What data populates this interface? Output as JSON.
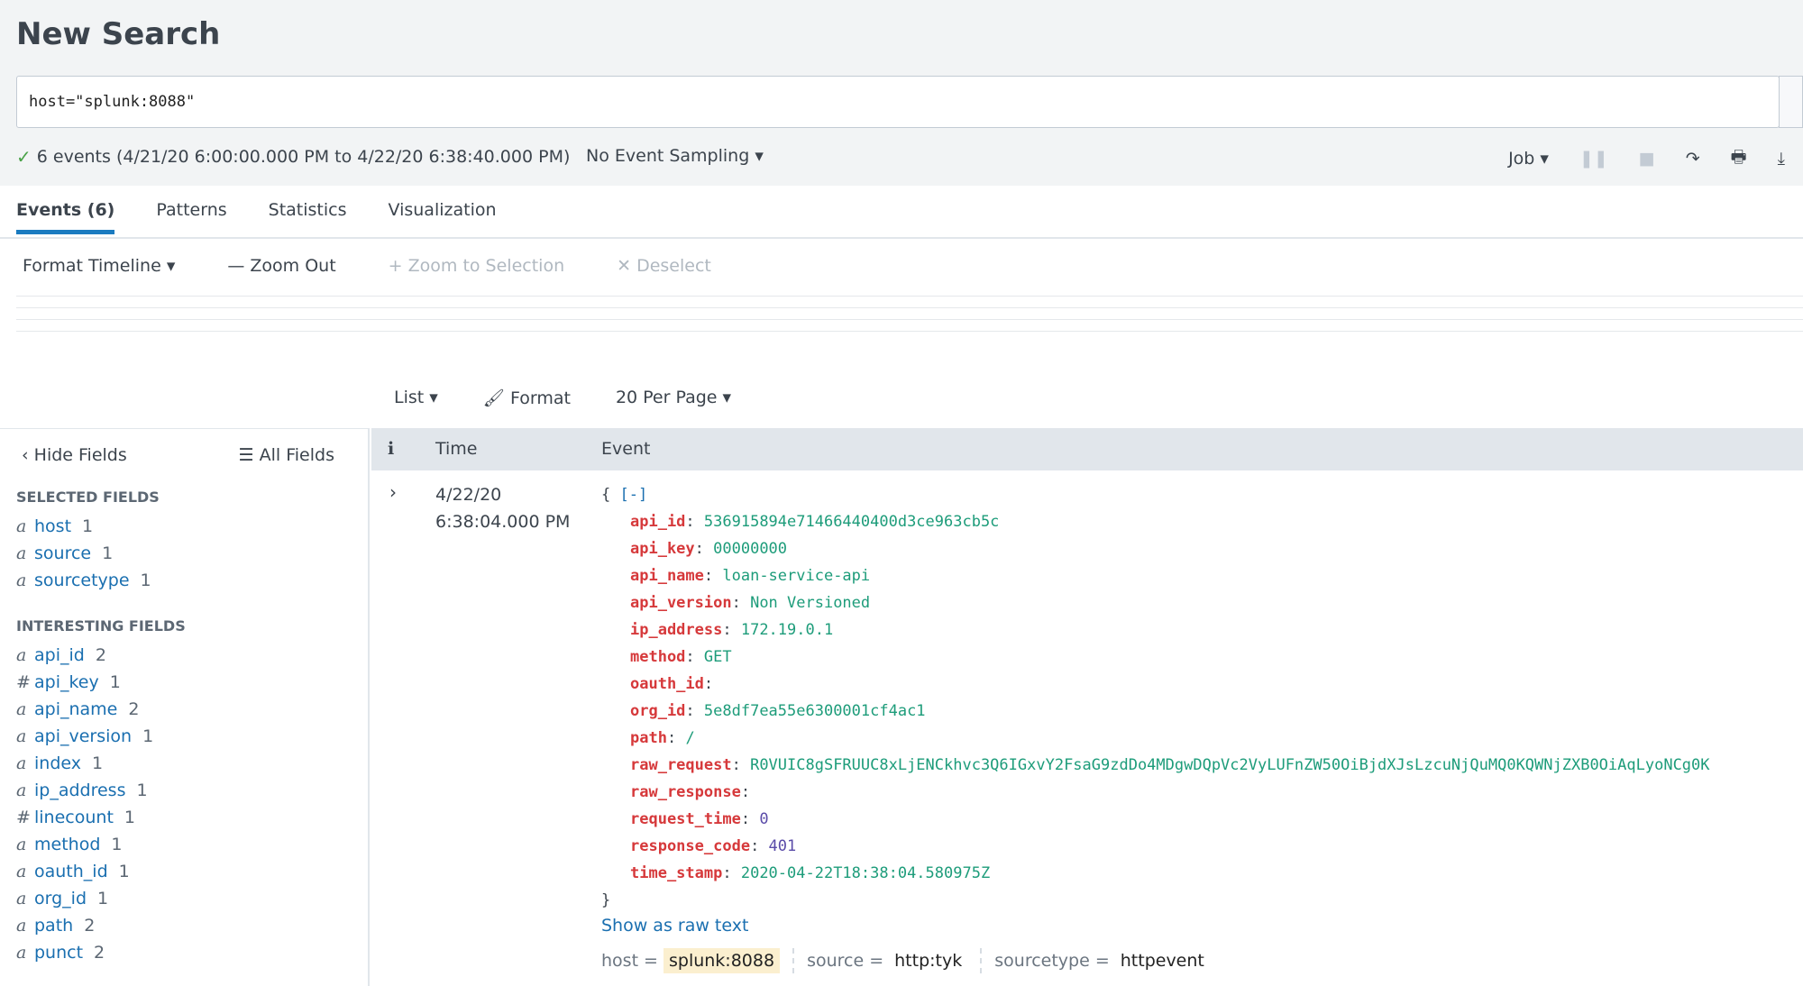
{
  "page": {
    "title": "New Search"
  },
  "search": {
    "query": "host=\"splunk:8088\""
  },
  "status": {
    "text": "6 events (4/21/20 6:00:00.000 PM to 4/22/20 6:38:40.000 PM)",
    "sampling": "No Event Sampling ▾"
  },
  "jobbar": {
    "job": "Job ▾"
  },
  "tabs": [
    "Events (6)",
    "Patterns",
    "Statistics",
    "Visualization"
  ],
  "timeline": {
    "format": "Format Timeline ▾",
    "zoom_out": "— Zoom Out",
    "zoom_sel": "+ Zoom to Selection",
    "deselect": "✕ Deselect"
  },
  "view": {
    "list": "List ▾",
    "format": "Format",
    "per_page": "20 Per Page ▾"
  },
  "sidebar": {
    "hide": "Hide Fields",
    "all": "All Fields",
    "selected_title": "SELECTED FIELDS",
    "interesting_title": "INTERESTING FIELDS",
    "selected": [
      {
        "type": "a",
        "name": "host",
        "count": "1"
      },
      {
        "type": "a",
        "name": "source",
        "count": "1"
      },
      {
        "type": "a",
        "name": "sourcetype",
        "count": "1"
      }
    ],
    "interesting": [
      {
        "type": "a",
        "name": "api_id",
        "count": "2"
      },
      {
        "type": "#",
        "name": "api_key",
        "count": "1"
      },
      {
        "type": "a",
        "name": "api_name",
        "count": "2"
      },
      {
        "type": "a",
        "name": "api_version",
        "count": "1"
      },
      {
        "type": "a",
        "name": "index",
        "count": "1"
      },
      {
        "type": "a",
        "name": "ip_address",
        "count": "1"
      },
      {
        "type": "#",
        "name": "linecount",
        "count": "1"
      },
      {
        "type": "a",
        "name": "method",
        "count": "1"
      },
      {
        "type": "a",
        "name": "oauth_id",
        "count": "1"
      },
      {
        "type": "a",
        "name": "org_id",
        "count": "1"
      },
      {
        "type": "a",
        "name": "path",
        "count": "2"
      },
      {
        "type": "a",
        "name": "punct",
        "count": "2"
      }
    ]
  },
  "table": {
    "info": "i",
    "time_h": "Time",
    "event_h": "Event"
  },
  "event": {
    "date": "4/22/20",
    "time": "6:38:04.000 PM",
    "open": "{",
    "collapse": "[-]",
    "close": "}",
    "fields": [
      {
        "k": "api_id",
        "v": "536915894e71466440400d3ce963cb5c",
        "t": "s"
      },
      {
        "k": "api_key",
        "v": "00000000",
        "t": "s"
      },
      {
        "k": "api_name",
        "v": "loan-service-api",
        "t": "s"
      },
      {
        "k": "api_version",
        "v": "Non Versioned",
        "t": "s"
      },
      {
        "k": "ip_address",
        "v": "172.19.0.1",
        "t": "s"
      },
      {
        "k": "method",
        "v": "GET",
        "t": "s"
      },
      {
        "k": "oauth_id",
        "v": "",
        "t": "s"
      },
      {
        "k": "org_id",
        "v": "5e8df7ea55e6300001cf4ac1",
        "t": "s"
      },
      {
        "k": "path",
        "v": "/",
        "t": "s"
      },
      {
        "k": "raw_request",
        "v": "R0VUIC8gSFRUUC8xLjENCkhvc3Q6IGxvY2FsaG9zdDo4MDgwDQpVc2VyLUFnZW50OiBjdXJsLzcuNjQuMQ0KQWNjZXB0OiAqLyoNCg0K",
        "t": "s"
      },
      {
        "k": "raw_response",
        "v": "",
        "t": "s"
      },
      {
        "k": "request_time",
        "v": "0",
        "t": "n"
      },
      {
        "k": "response_code",
        "v": "401",
        "t": "n"
      },
      {
        "k": "time_stamp",
        "v": "2020-04-22T18:38:04.580975Z",
        "t": "s"
      }
    ],
    "show_raw": "Show as raw text",
    "meta": [
      {
        "k": "host =",
        "v": "splunk:8088"
      },
      {
        "k": "source =",
        "v": "http:tyk"
      },
      {
        "k": "sourcetype =",
        "v": "httpevent"
      }
    ]
  }
}
